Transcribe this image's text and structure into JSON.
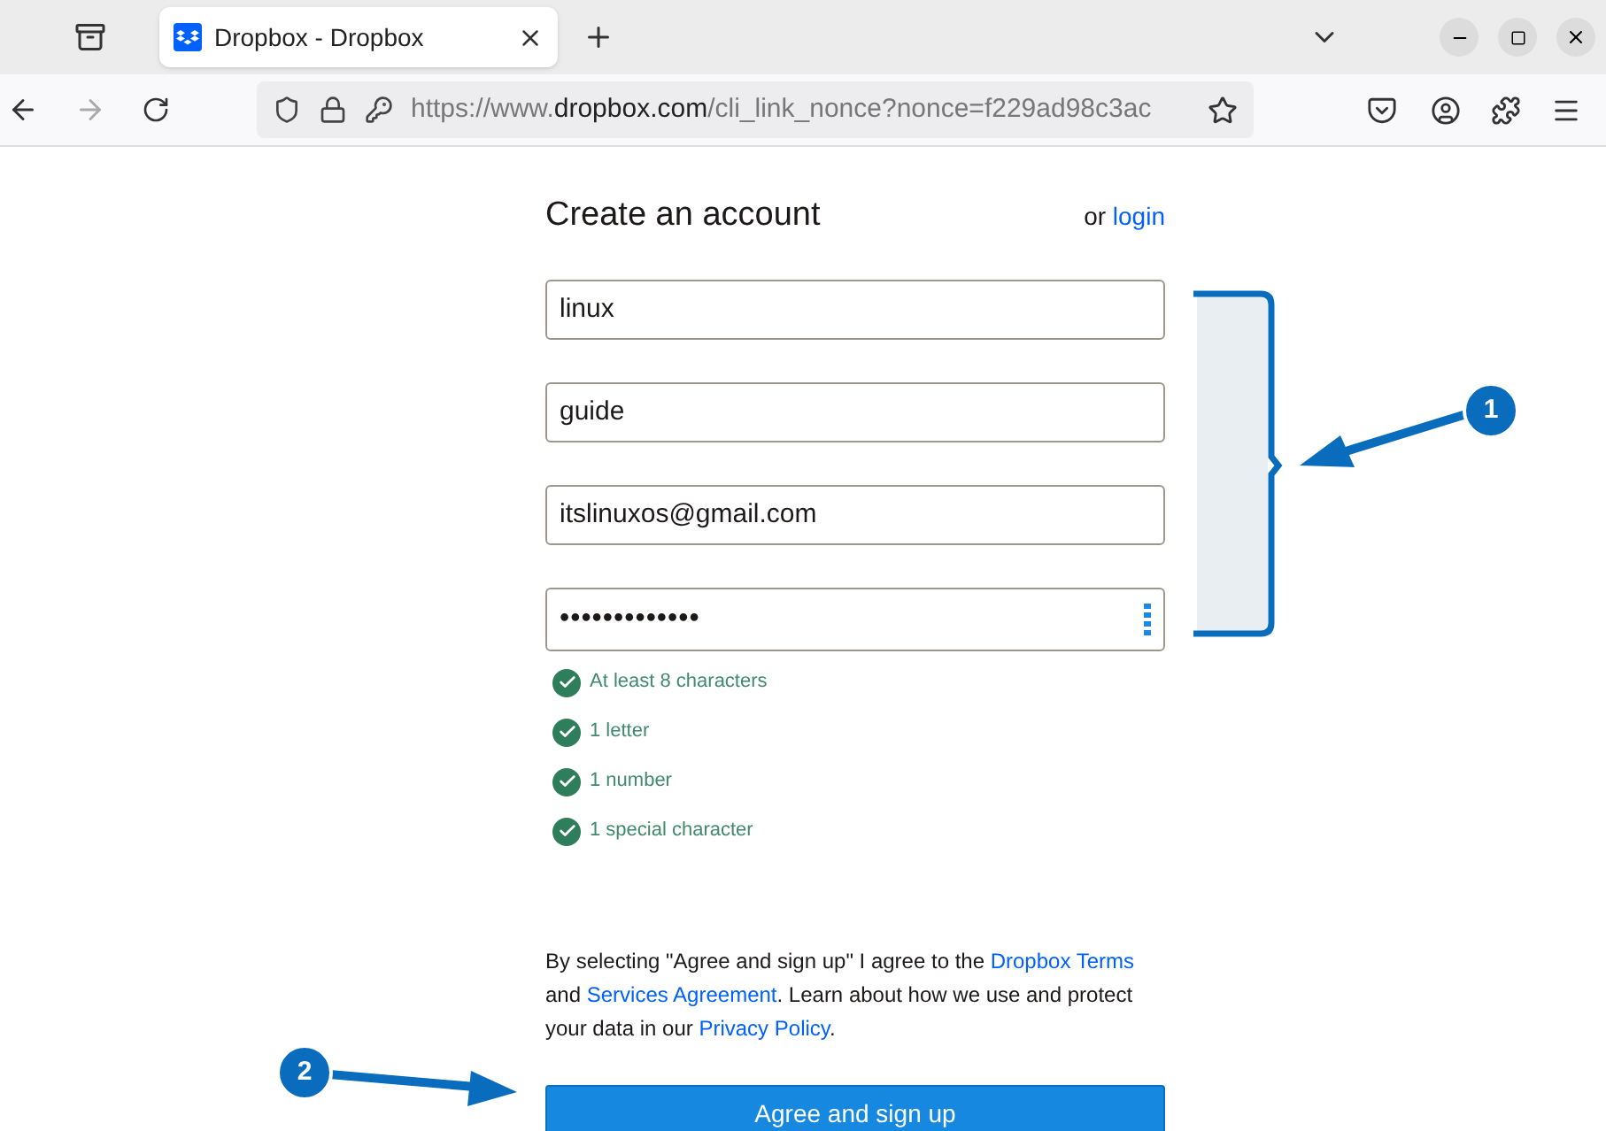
{
  "browser": {
    "tab": {
      "title": "Dropbox - Dropbox"
    },
    "url": {
      "prefix": "https://www.",
      "domain": "dropbox.com",
      "path": "/cli_link_nonce?nonce=f229ad98c3ac"
    }
  },
  "form": {
    "title": "Create an account",
    "alt_prefix": "or",
    "alt_link": "login",
    "fields": [
      {
        "kind": "text",
        "value": "linux"
      },
      {
        "kind": "text",
        "value": "guide"
      },
      {
        "kind": "text",
        "value": "itslinuxos@gmail.com"
      },
      {
        "kind": "password",
        "value": "•••••••••••••"
      }
    ],
    "rules": [
      {
        "label": "At least 8 characters",
        "checked": true
      },
      {
        "label": "1 letter",
        "checked": true
      },
      {
        "label": "1 number",
        "checked": true
      },
      {
        "label": "1 special character",
        "checked": true
      }
    ],
    "legal": [
      {
        "text": "By selecting \"Agree and sign up\" I agree to the ",
        "link": false
      },
      {
        "text": "Dropbox Terms",
        "link": true
      },
      {
        "text": " and ",
        "link": false
      },
      {
        "text": "Services Agreement",
        "link": true
      },
      {
        "text": ". Learn about how we use and protect your data in our ",
        "link": false
      },
      {
        "text": "Privacy Policy",
        "link": true
      },
      {
        "text": ".",
        "link": false
      }
    ],
    "button": "Agree and sign up"
  },
  "annotations": [
    {
      "number": "1"
    },
    {
      "number": "2"
    }
  ]
}
